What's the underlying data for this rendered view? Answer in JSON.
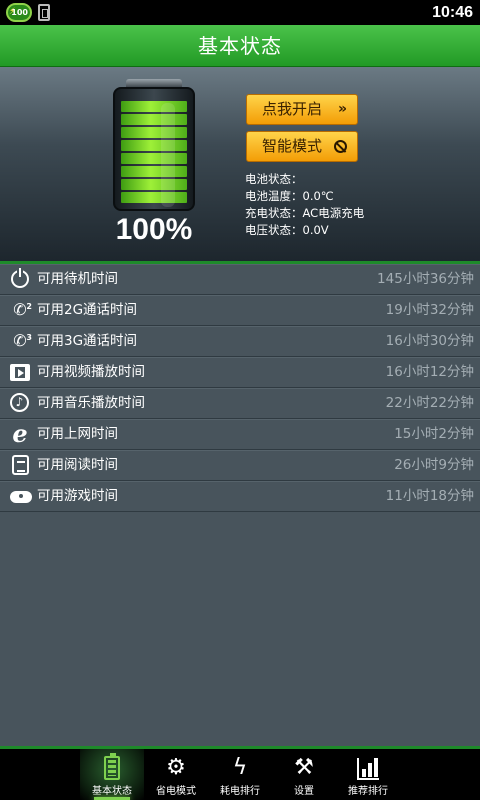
{
  "status_bar": {
    "battery_badge": "100",
    "time": "10:46"
  },
  "title": "基本状态",
  "battery": {
    "level_percent": 100,
    "percent_label": "100%",
    "cells": 8,
    "color": "#8fe03a"
  },
  "actions": {
    "start_label": "点我开启",
    "start_icon": "»",
    "smart_label": "智能模式"
  },
  "info": {
    "status": "电池状态：",
    "temperature": "电池温度：0.0℃",
    "charging": "充电状态：AC电源充电",
    "voltage": "电压状态：0.0V"
  },
  "list": [
    {
      "icon": "power-icon",
      "label": "可用待机时间",
      "value": "145小时36分钟"
    },
    {
      "icon": "phone-2g-icon",
      "label": "可用2G通话时间",
      "value": "19小时32分钟"
    },
    {
      "icon": "phone-3g-icon",
      "label": "可用3G通话时间",
      "value": "16小时30分钟"
    },
    {
      "icon": "video-icon",
      "label": "可用视频播放时间",
      "value": "16小时12分钟"
    },
    {
      "icon": "music-icon",
      "label": "可用音乐播放时间",
      "value": "22小时22分钟"
    },
    {
      "icon": "browser-icon",
      "label": "可用上网时间",
      "value": "15小时2分钟"
    },
    {
      "icon": "book-icon",
      "label": "可用阅读时间",
      "value": "26小时9分钟"
    },
    {
      "icon": "gamepad-icon",
      "label": "可用游戏时间",
      "value": "11小时18分钟"
    }
  ],
  "nav": [
    {
      "icon": "battery-icon",
      "label": "基本状态",
      "active": true
    },
    {
      "icon": "gear-bolt-icon",
      "label": "省电模式",
      "active": false
    },
    {
      "icon": "lightning-icon",
      "label": "耗电排行",
      "active": false
    },
    {
      "icon": "tools-icon",
      "label": "设置",
      "active": false
    },
    {
      "icon": "bar-chart-icon",
      "label": "推荐排行",
      "active": false
    }
  ],
  "colors": {
    "accent_green": "#2ea82f",
    "button_orange": "#f5a912",
    "list_bg": "#48545c"
  }
}
